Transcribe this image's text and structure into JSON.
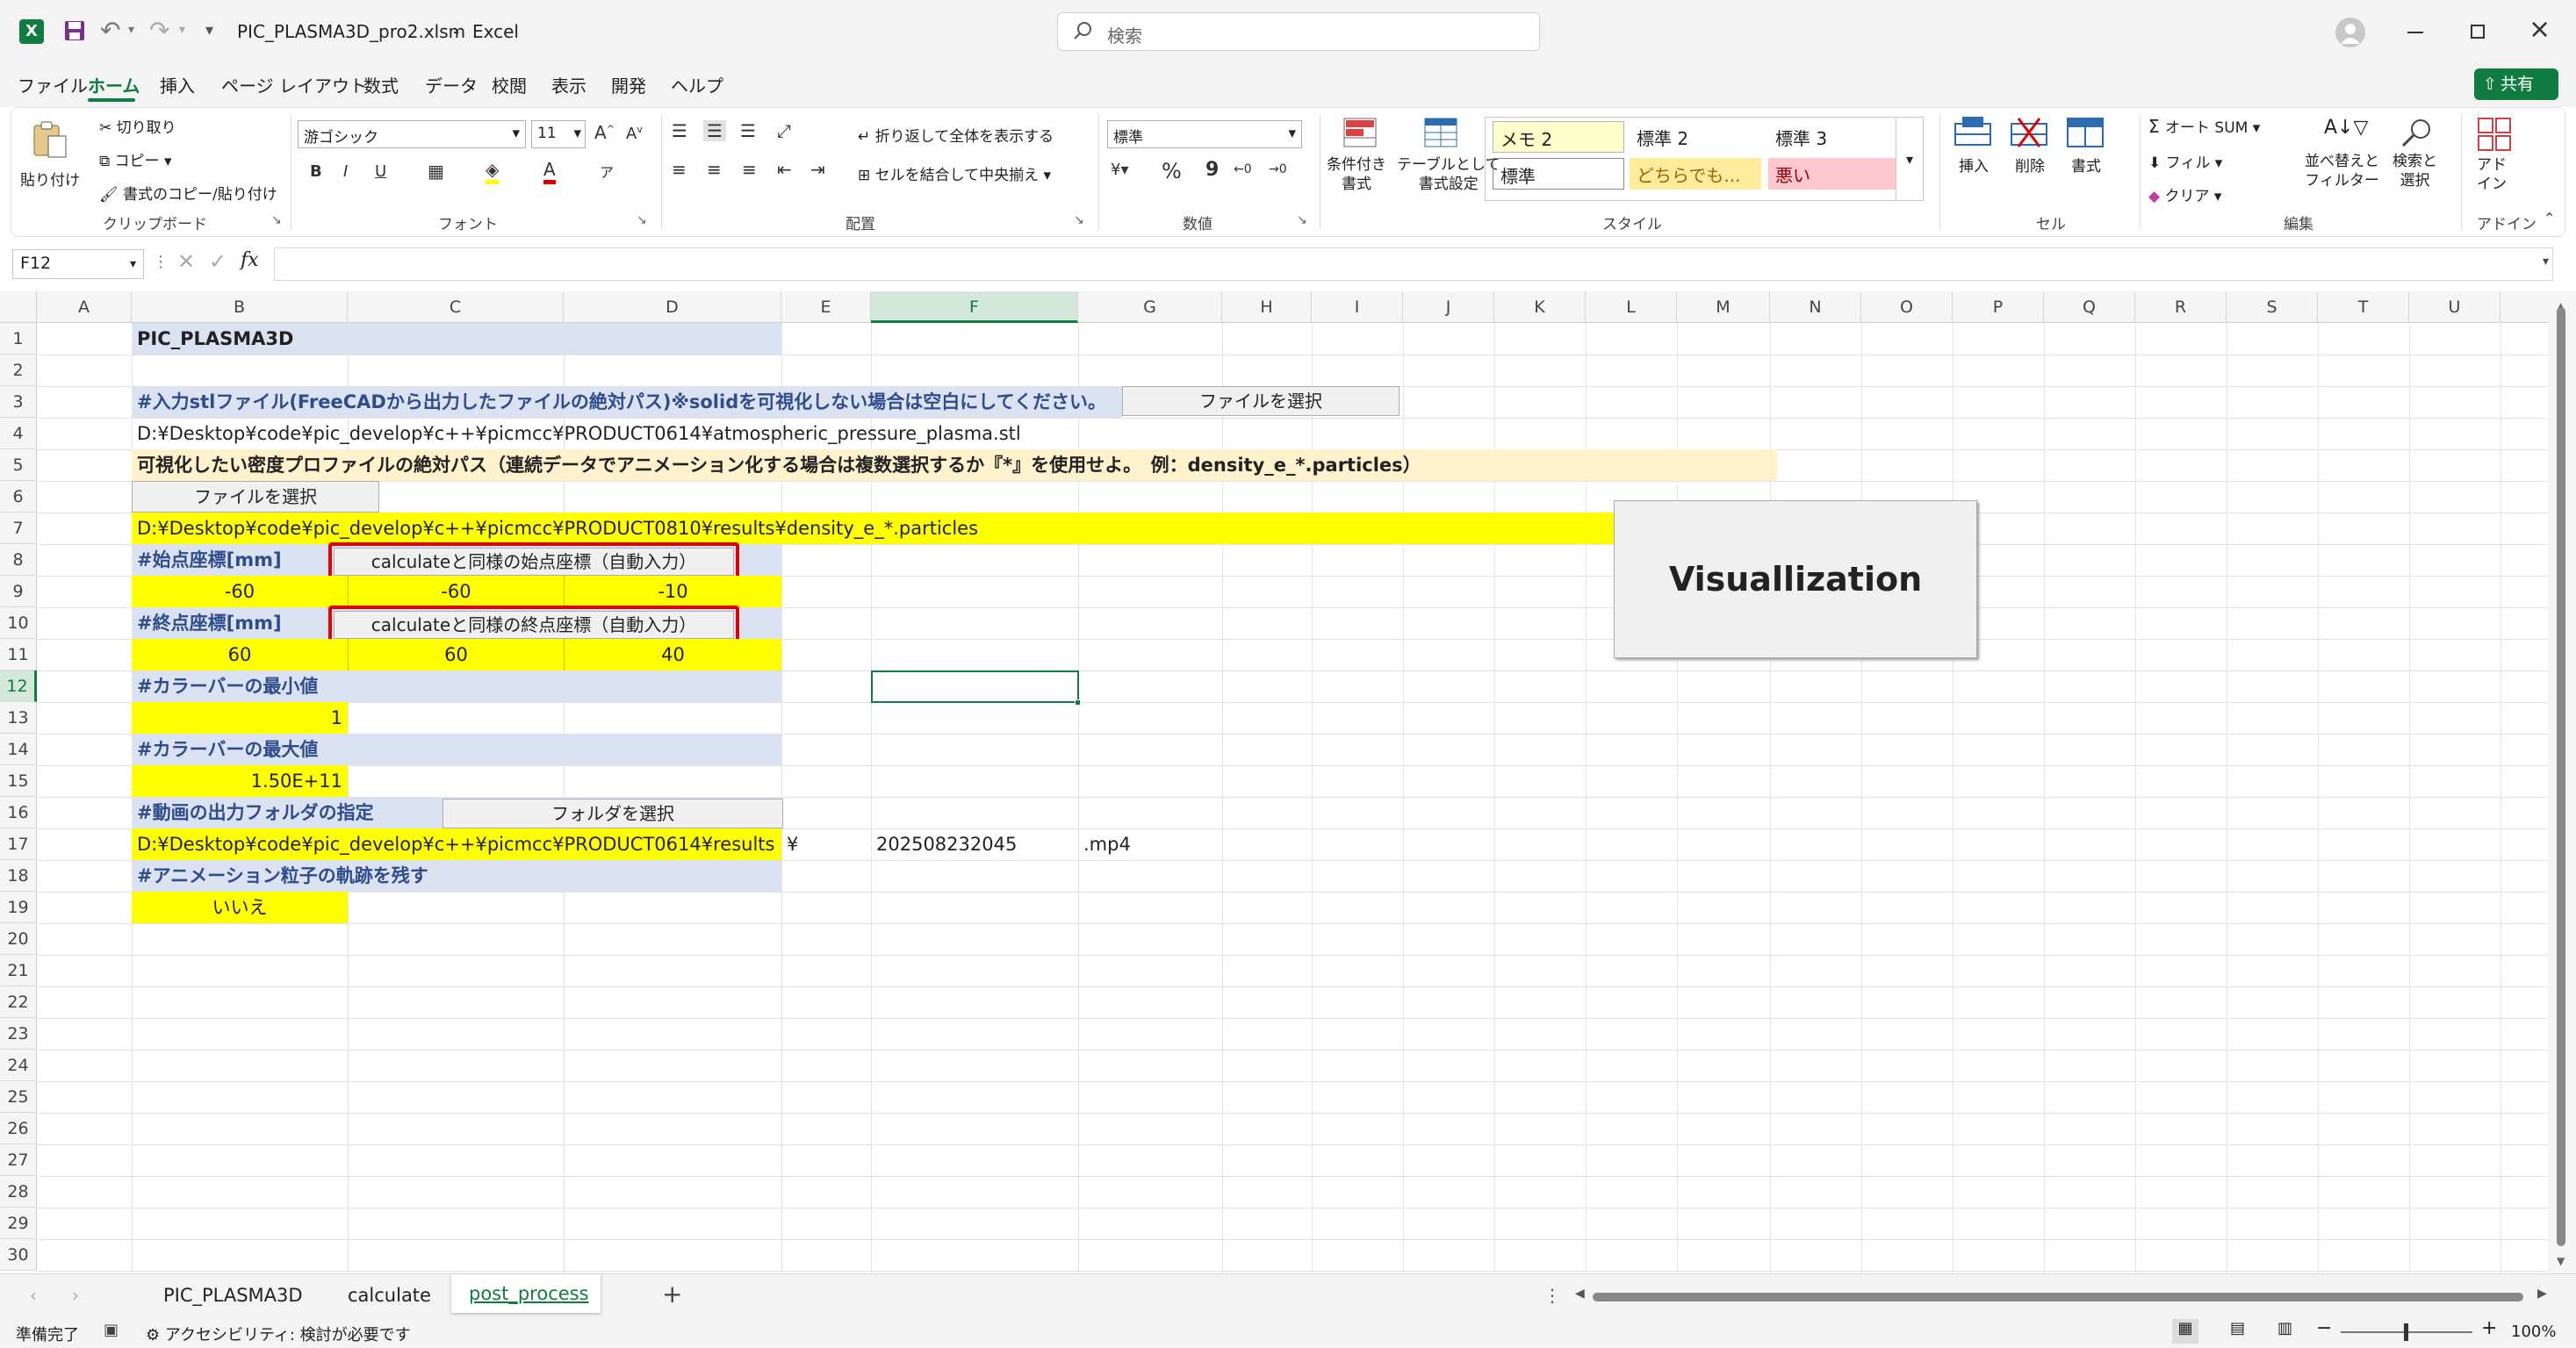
{
  "window": {
    "filename": "PIC_PLASMA3D_pro2.xlsm",
    "app": "Excel",
    "search_placeholder": "検索",
    "quick_access_dropdown": "▾"
  },
  "menu": {
    "tabs": [
      "ファイル",
      "ホーム",
      "挿入",
      "ページ レイアウト",
      "数式",
      "データ",
      "校閲",
      "表示",
      "開発",
      "ヘルプ"
    ],
    "active": "ホーム",
    "share": "共有"
  },
  "ribbon": {
    "clipboard": {
      "paste": "貼り付け",
      "cut": "切り取り",
      "copy": "コピー",
      "format_painter": "書式のコピー/貼り付け",
      "label": "クリップボード"
    },
    "font": {
      "name": "游ゴシック",
      "size": "11",
      "label": "フォント",
      "bold": "B",
      "italic": "I",
      "underline": "U"
    },
    "alignment": {
      "wrap": "折り返して全体を表示する",
      "merge": "セルを結合して中央揃え",
      "label": "配置"
    },
    "number": {
      "format": "標準",
      "percent": "%",
      "comma": "9",
      "label": "数値"
    },
    "styles": {
      "conditional": "条件付き\n書式",
      "table": "テーブルとして\n書式設定",
      "memo2": "メモ 2",
      "standard2": "標準 2",
      "standard3": "標準 3",
      "standard": "標準",
      "neutral": "どちらでも...",
      "bad": "悪い",
      "label": "スタイル"
    },
    "cells": {
      "insert": "挿入",
      "delete": "削除",
      "format": "書式",
      "label": "セル"
    },
    "editing": {
      "autosum": "オート SUM",
      "fill": "フィル",
      "clear": "クリア",
      "sort": "並べ替えと\nフィルター",
      "find": "検索と\n選択",
      "label": "編集"
    },
    "addins": {
      "addin": "アド\nイン",
      "label": "アドイン"
    }
  },
  "formula_bar": {
    "name_box": "F12",
    "fx": "fx",
    "value": ""
  },
  "columns": [
    "A",
    "B",
    "C",
    "D",
    "E",
    "F",
    "G",
    "H",
    "I",
    "J",
    "K",
    "L",
    "M",
    "N",
    "O",
    "P",
    "Q",
    "R",
    "S",
    "T",
    "U"
  ],
  "rows": [
    "1",
    "2",
    "3",
    "4",
    "5",
    "6",
    "7",
    "8",
    "9",
    "10",
    "11",
    "12",
    "13",
    "14",
    "15",
    "16",
    "17",
    "18",
    "19",
    "20",
    "21",
    "22",
    "23",
    "24",
    "25",
    "26",
    "27",
    "28",
    "29",
    "30"
  ],
  "sheet": {
    "title": "PIC_PLASMA3D",
    "stl_header": "#入力stlファイル(FreeCADから出力したファイルの絶対パス)※solidを可視化しない場合は空白にしてください。",
    "stl_button": "ファイルを選択",
    "stl_path": "D:¥Desktop¥code¥pic_develop¥c++¥picmcc¥PRODUCT0614¥atmospheric_pressure_plasma.stl",
    "density_header": "可視化したい密度プロファイルの絶対パス（連続データでアニメーション化する場合は複数選択するか『*』を使用せよ。　例：density_e_*.particles）",
    "density_button": "ファイルを選択",
    "density_path": "D:¥Desktop¥code¥pic_develop¥c++¥picmcc¥PRODUCT0810¥results¥density_e_*.particles",
    "start_header": "#始点座標[mm]",
    "start_button": "calculateと同様の始点座標（自動入力）",
    "start_x": "-60",
    "start_y": "-60",
    "start_z": "-10",
    "end_header": "#終点座標[mm]",
    "end_button": "calculateと同様の終点座標（自動入力）",
    "end_x": "60",
    "end_y": "60",
    "end_z": "40",
    "cmin_header": "#カラーバーの最小値",
    "cmin": "1",
    "cmax_header": "#カラーバーの最大値",
    "cmax": "1.50E+11",
    "out_header": "#動画の出力フォルダの指定",
    "out_button": "フォルダを選択",
    "out_path": "D:¥Desktop¥code¥pic_develop¥c++¥picmcc¥PRODUCT0614¥results",
    "out_sep": "¥",
    "out_stamp": "202508232045",
    "out_ext": ".mp4",
    "trail_header": "#アニメーション粒子の軌跡を残す",
    "trail_value": "いいえ",
    "visual_button": "Visuallization"
  },
  "sheet_tabs": {
    "tabs": [
      "PIC_PLASMA3D",
      "calculate",
      "post_process"
    ],
    "active": "post_process",
    "add": "+"
  },
  "status": {
    "ready": "準備完了",
    "accessibility": "アクセシビリティ: 検討が必要です",
    "zoom": "100%"
  },
  "colors": {
    "excel_green": "#107c41",
    "header_blue": "#dbe2f2",
    "highlight_yellow": "#ffff00",
    "cream": "#fff2cc",
    "red_outline": "#e00000"
  }
}
